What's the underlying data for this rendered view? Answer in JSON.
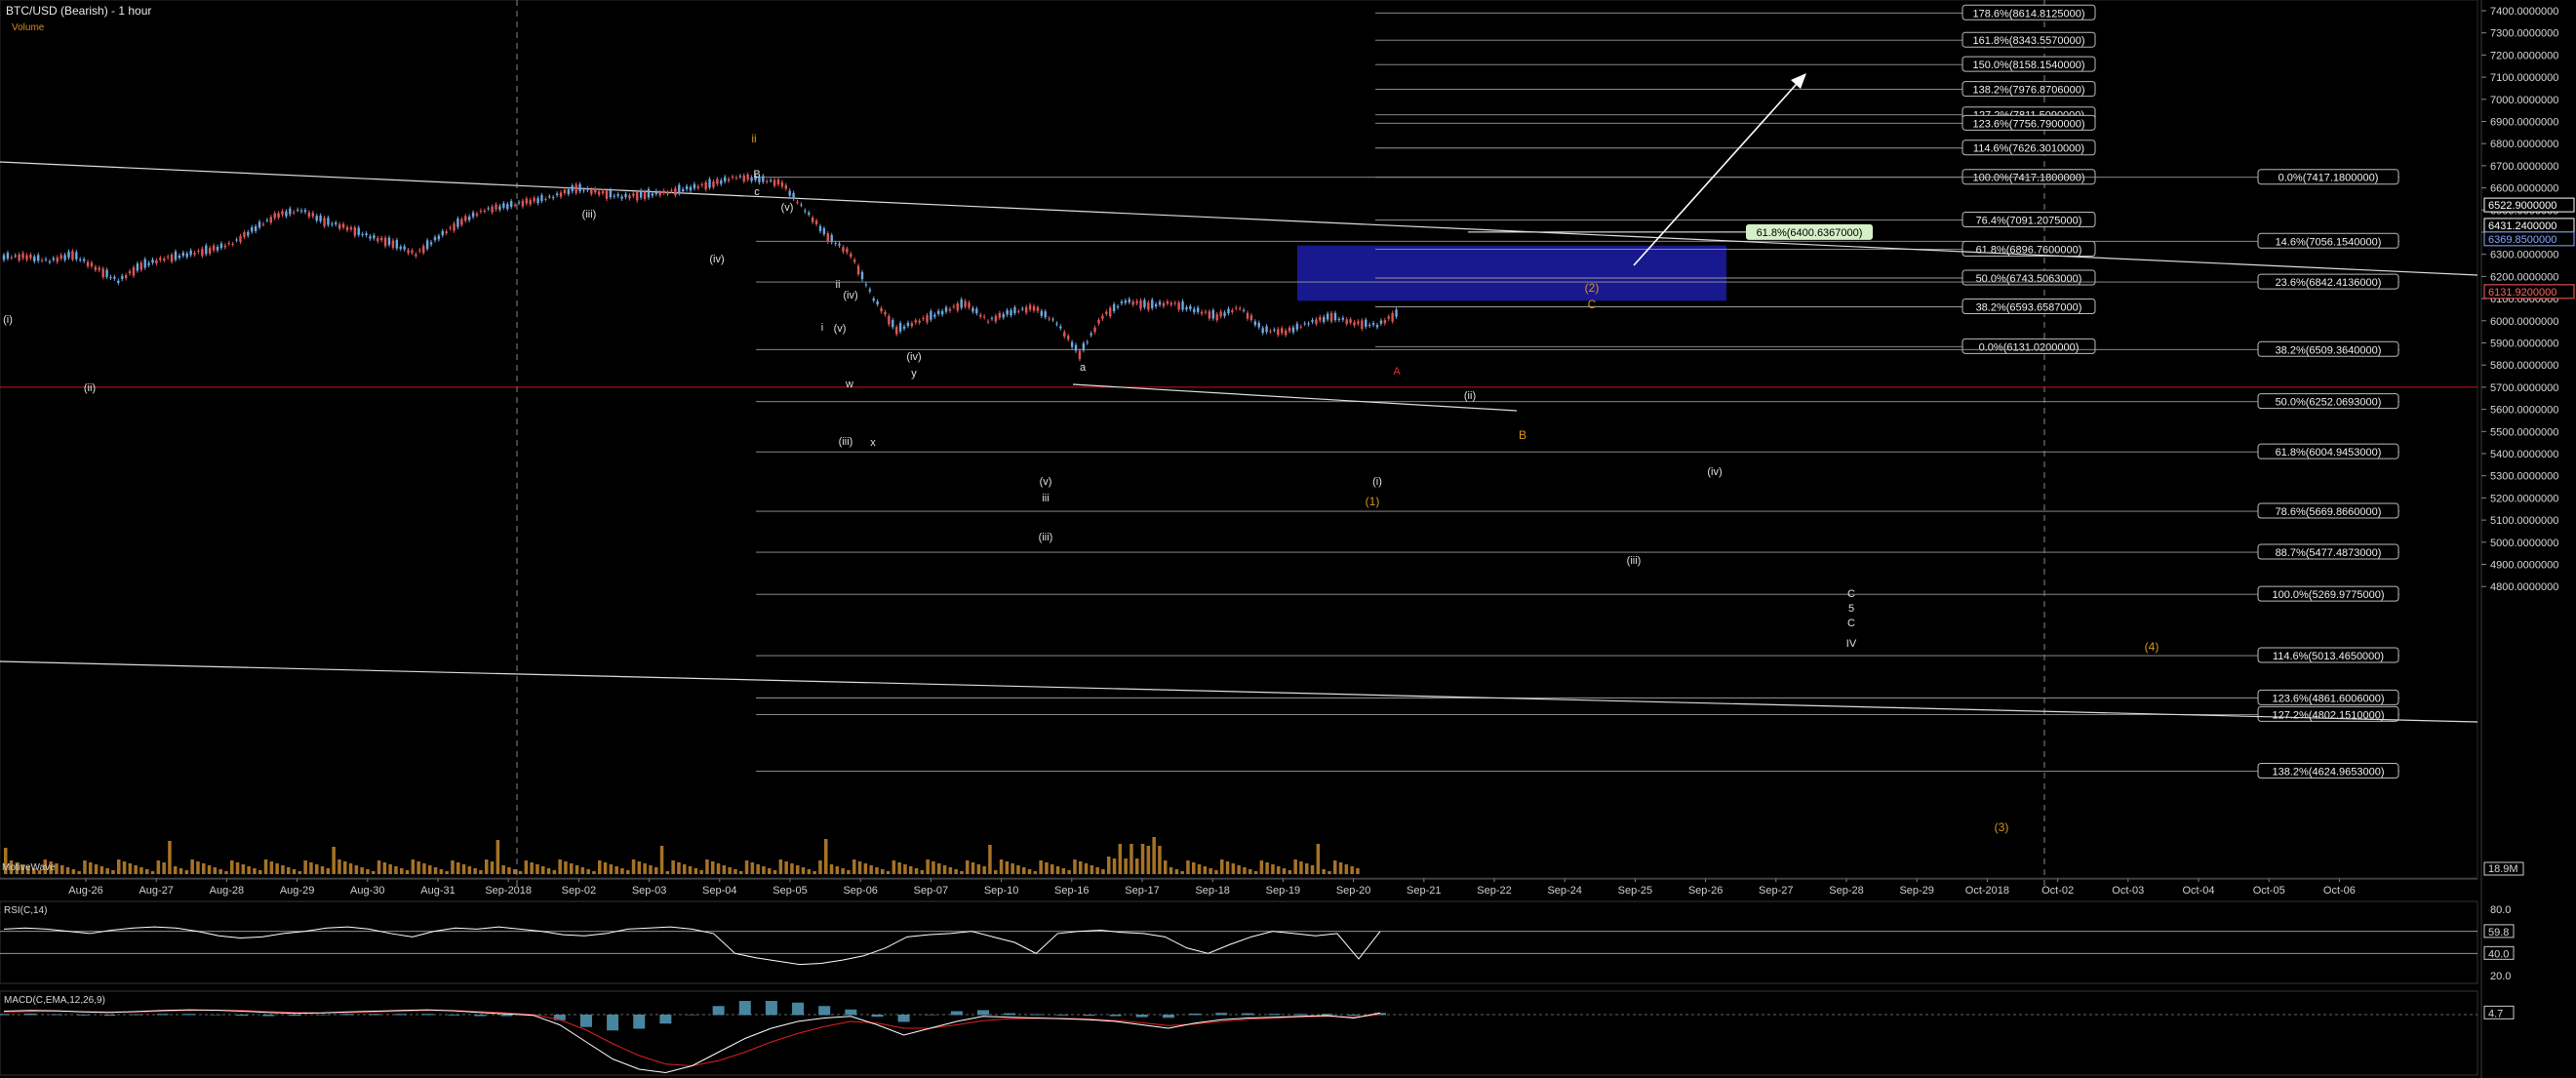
{
  "app": {
    "title": "BTC/USD (Bearish) - 1 hour",
    "volume_label": "Volume",
    "watermark": "MotiveWave",
    "volume_readout": "18.9M"
  },
  "colors": {
    "background": "#000000",
    "grid": "#3a3a3a",
    "fib_line": "#9a9a9a",
    "up_candle": "#6ea8e0",
    "down_candle": "#e05555",
    "target_box": "#1c1ca8",
    "wave_white": "#e0e0e0",
    "wave_orange": "#d8961c",
    "wave_red": "#e03030",
    "support_line": "#c01818",
    "rsi_line": "#ffffff",
    "macd_line": "#ffffff",
    "macd_signal": "#e02020",
    "macd_hist": "#5aa8c8",
    "rsi_fill_up": "#8890a0",
    "rsi_fill_down": "#b07080",
    "volume_bar": "#b8802a"
  },
  "chart_data": [
    {
      "type": "line",
      "title": "BTC/USD (Bearish) - 1 hour",
      "ylim": [
        4700,
        7450
      ],
      "y_ticks": [
        "7400.0000000",
        "7300.0000000",
        "7200.0000000",
        "7100.0000000",
        "7000.0000000",
        "6900.0000000",
        "6800.0000000",
        "6700.0000000",
        "6600.0000000",
        "6500.0000000",
        "6400.0000000",
        "6300.0000000",
        "6200.0000000",
        "6100.0000000",
        "6000.0000000",
        "5900.0000000",
        "5800.0000000",
        "5700.0000000",
        "5600.0000000",
        "5500.0000000",
        "5400.0000000",
        "5300.0000000",
        "5200.0000000",
        "5100.0000000",
        "5000.0000000",
        "4900.0000000",
        "4800.0000000"
      ],
      "x_ticks": [
        "Aug-26",
        "Aug-27",
        "Aug-28",
        "Aug-29",
        "Aug-30",
        "Aug-31",
        "Sep-2018",
        "Sep-02",
        "Sep-03",
        "Sep-04",
        "Sep-05",
        "Sep-06",
        "Sep-07",
        "Sep-10",
        "Sep-16",
        "Sep-17",
        "Sep-18",
        "Sep-19",
        "Sep-20",
        "Sep-21",
        "Sep-22",
        "Sep-24",
        "Sep-25",
        "Sep-26",
        "Sep-27",
        "Sep-28",
        "Sep-29",
        "Oct-2018",
        "Oct-02",
        "Oct-03",
        "Oct-04",
        "Oct-05",
        "Oct-06"
      ],
      "price_series": [
        6290,
        6270,
        6300,
        6240,
        6180,
        6250,
        6280,
        6300,
        6320,
        6350,
        6420,
        6480,
        6500,
        6450,
        6420,
        6380,
        6350,
        6300,
        6380,
        6450,
        6500,
        6520,
        6540,
        6560,
        6600,
        6580,
        6560,
        6570,
        6580,
        6600,
        6620,
        6650,
        6640,
        6620,
        6500,
        6380,
        6300,
        6100,
        5960,
        6000,
        6040,
        6080,
        6000,
        6040,
        6060,
        5990,
        5850,
        6020,
        6090,
        6070,
        6080,
        6050,
        6020,
        6060,
        5960,
        5950,
        5990,
        6020,
        5990,
        5980,
        6040
      ],
      "price_markers": [
        {
          "label": "6522.9000000",
          "value": 6522.9,
          "color": "#ffffff"
        },
        {
          "label": "6431.2400000",
          "value": 6431.24,
          "color": "#ffffff"
        },
        {
          "label": "6369.8500000",
          "value": 6369.85,
          "color": "#8aa8ff"
        },
        {
          "label": "6131.9200000",
          "value": 6131.92,
          "color": "#ff6060"
        }
      ],
      "fib_levels_upper": [
        {
          "label": "178.6%(8614.8125000)",
          "value": 7390
        },
        {
          "label": "161.8%(8343.5570000)",
          "value": 7267
        },
        {
          "label": "150.0%(8158.1540000)",
          "value": 7157
        },
        {
          "label": "138.2%(7976.8706000)",
          "value": 7045
        },
        {
          "label": "127.2%(7811.5090000)",
          "value": 6930
        },
        {
          "label": "123.6%(7756.7900000)",
          "value": 6892
        },
        {
          "label": "114.6%(7626.3010000)",
          "value": 6780
        },
        {
          "label": "100.0%(7417.1800000)",
          "value": 6648
        },
        {
          "label": "76.4%(7091.2075000)",
          "value": 6455
        },
        {
          "label": "61.8%(6896.7600000)",
          "value": 6323
        },
        {
          "label": "50.0%(6743.5063000)",
          "value": 6193
        },
        {
          "label": "38.2%(6593.6587000)",
          "value": 6063
        },
        {
          "label": "0.0%(6131.0200000)",
          "value": 5883
        }
      ],
      "fib_levels_right": [
        {
          "label": "0.0%(7417.1800000)",
          "value": 6648
        },
        {
          "label": "14.6%(7056.1540000)",
          "value": 6359
        },
        {
          "label": "23.6%(6842.4136000)",
          "value": 6175
        },
        {
          "label": "38.2%(6509.3640000)",
          "value": 5870
        },
        {
          "label": "50.0%(6252.0693000)",
          "value": 5635
        },
        {
          "label": "61.8%(6004.9453000)",
          "value": 5408
        },
        {
          "label": "78.6%(5669.8660000)",
          "value": 5140
        },
        {
          "label": "88.7%(5477.4873000)",
          "value": 4955
        },
        {
          "label": "100.0%(5269.9775000)",
          "value": 4765
        },
        {
          "label": "114.6%(5013.4650000)",
          "value": 4488
        },
        {
          "label": "123.6%(4861.6006000)",
          "value": 4297
        },
        {
          "label": "127.2%(4802.1510000)",
          "value": 4222
        },
        {
          "label": "138.2%(4624.9653000)",
          "value": 3966
        }
      ],
      "fib_callout": {
        "label": "61.8%(6400.6367000)",
        "value": 6400.64
      },
      "support_level": 5700,
      "wave_labels": [
        "(i)",
        "(ii)",
        "(iii)",
        "(iv)",
        "(v)",
        "ii",
        "B",
        "c",
        "(iii)",
        "(iv)",
        "(v)",
        "ii",
        "i",
        "w",
        "x",
        "y",
        "(iv)",
        "(iii)",
        "(v)",
        "iii",
        "a",
        "(i)",
        "(1)",
        "A",
        "(ii)",
        "B",
        "(iv)",
        "(2)",
        "C",
        "(iii)",
        "C",
        "5",
        "C",
        "IV",
        "(4)",
        "(3)"
      ]
    },
    {
      "type": "line",
      "title": "RSI(C,14)",
      "ylim": [
        20,
        80
      ],
      "y_ticks": [
        "80.0",
        "20.0"
      ],
      "levels": [
        60,
        40
      ],
      "readouts": [
        {
          "label": "59.8",
          "value": 59.8
        },
        {
          "label": "40.0",
          "value": 40.0
        }
      ],
      "values": [
        62,
        63,
        62,
        60,
        58,
        61,
        63,
        64,
        63,
        60,
        56,
        54,
        55,
        58,
        60,
        63,
        64,
        62,
        58,
        55,
        60,
        63,
        62,
        64,
        62,
        60,
        57,
        56,
        58,
        62,
        63,
        64,
        62,
        58,
        40,
        36,
        33,
        30,
        31,
        34,
        38,
        45,
        55,
        57,
        58,
        60,
        55,
        50,
        40,
        58,
        60,
        61,
        59,
        58,
        55,
        45,
        40,
        48,
        55,
        60,
        58,
        56,
        58,
        35,
        60
      ]
    },
    {
      "type": "line",
      "title": "MACD(C,EMA,12,26,9)",
      "readouts": [
        {
          "label": "4.7",
          "value": 4.7
        }
      ],
      "macd": [
        10,
        12,
        11,
        8,
        6,
        9,
        12,
        14,
        13,
        10,
        6,
        4,
        5,
        8,
        10,
        12,
        14,
        11,
        6,
        2,
        -2,
        -30,
        -80,
        -130,
        -160,
        -170,
        -150,
        -110,
        -70,
        -40,
        -20,
        -10,
        -5,
        -30,
        -60,
        -40,
        -20,
        -5,
        -8,
        -10,
        -12,
        -15,
        -20,
        -30,
        -40,
        -25,
        -15,
        -10,
        -8,
        -5,
        -3,
        -10,
        4.7
      ],
      "signal": [
        8,
        9,
        10,
        9,
        8,
        8,
        10,
        12,
        13,
        12,
        9,
        6,
        5,
        6,
        8,
        10,
        12,
        12,
        9,
        5,
        0,
        -15,
        -45,
        -85,
        -120,
        -145,
        -150,
        -135,
        -110,
        -80,
        -55,
        -35,
        -20,
        -25,
        -40,
        -40,
        -30,
        -18,
        -12,
        -11,
        -11,
        -13,
        -17,
        -24,
        -32,
        -28,
        -20,
        -14,
        -10,
        -7,
        -5,
        -8,
        0
      ]
    }
  ]
}
